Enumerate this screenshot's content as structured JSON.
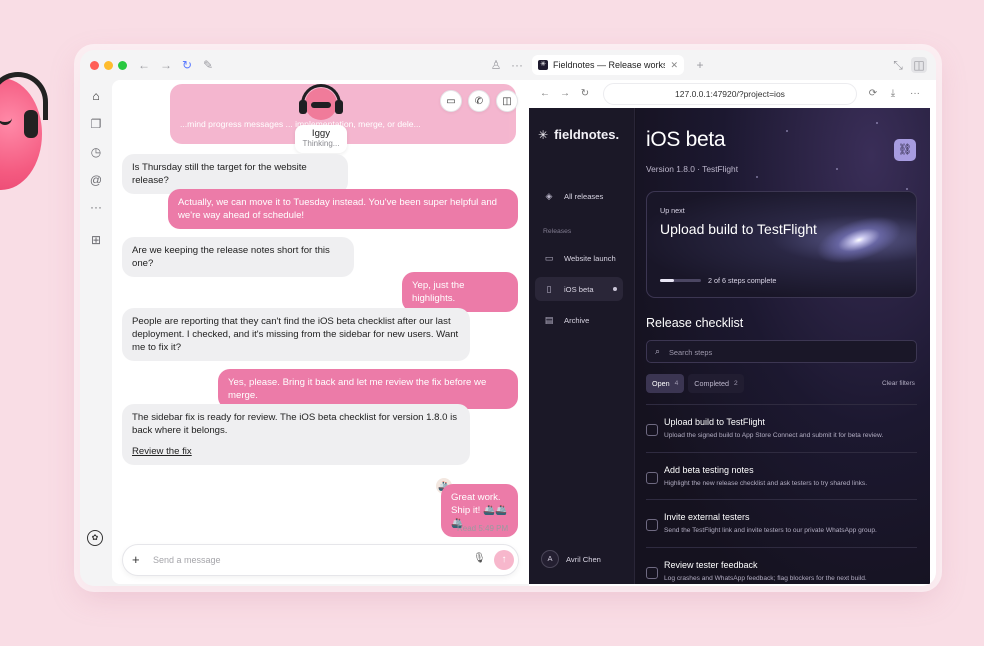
{
  "browser": {
    "tab_title": "Fieldnotes — Release workspace",
    "tab_favicon": "✳",
    "url": "127.0.0.1:47920/?project=ios"
  },
  "chat": {
    "agent": {
      "name": "Iggy",
      "status": "Thinking..."
    },
    "ghost_message": "...mind progress messages ... implementation, merge, or dele...",
    "messages": [
      {
        "role": "in",
        "text": "Is Thursday still the target for the website release?"
      },
      {
        "role": "out",
        "text": "Actually, we can move it to Tuesday instead. You've been super helpful and we're way ahead of schedule!"
      },
      {
        "role": "in",
        "text": "Are we keeping the release notes short for this one?"
      },
      {
        "role": "out",
        "text": "Yep, just the highlights."
      },
      {
        "role": "in",
        "text": "People are reporting that they can't find the iOS beta checklist after our last deployment. I checked, and it's missing from the sidebar for new users. Want me to fix it?"
      },
      {
        "role": "out",
        "text": "Yes, please. Bring it back and let me review the fix before we merge."
      },
      {
        "role": "in",
        "text": "The sidebar fix is ready for review. The iOS beta checklist for version 1.8.0 is back where it belongs.",
        "link": "Review the fix"
      },
      {
        "role": "out",
        "text": "Great work. Ship it! 🚢🚢🚢"
      }
    ],
    "read_status": "Read 5:49 PM",
    "composer_placeholder": "Send a message"
  },
  "app": {
    "logo": "fieldnotes.",
    "nav_all": "All releases",
    "section_label": "Releases",
    "releases": [
      {
        "label": "Website launch",
        "icon": "▭"
      },
      {
        "label": "iOS beta",
        "icon": "▯"
      },
      {
        "label": "Archive",
        "icon": "▤"
      }
    ],
    "user": {
      "initial": "A",
      "name": "Avril Chen"
    },
    "title": "iOS beta",
    "subtitle": "Version 1.8.0 · TestFlight",
    "up_next": {
      "label": "Up next",
      "title": "Upload build to TestFlight",
      "progress_text": "2 of 6 steps complete",
      "progress_fraction": 0.333
    },
    "checklist_title": "Release checklist",
    "search_placeholder": "Search steps",
    "filters": [
      {
        "label": "Open",
        "count": "4"
      },
      {
        "label": "Completed",
        "count": "2"
      }
    ],
    "clear_filters": "Clear filters",
    "items": [
      {
        "title": "Upload build to TestFlight",
        "desc": "Upload the signed build to App Store Connect and submit it for beta review."
      },
      {
        "title": "Add beta testing notes",
        "desc": "Highlight the new release checklist and ask testers to try shared links."
      },
      {
        "title": "Invite external testers",
        "desc": "Send the TestFlight link and invite testers to our private WhatsApp group."
      },
      {
        "title": "Review tester feedback",
        "desc": "Log crashes and WhatsApp feedback; flag blockers for the next build."
      }
    ]
  },
  "colors": {
    "accent_pink": "#ec7ba8",
    "app_bg": "#15121f",
    "link_button": "#a79ce0"
  }
}
